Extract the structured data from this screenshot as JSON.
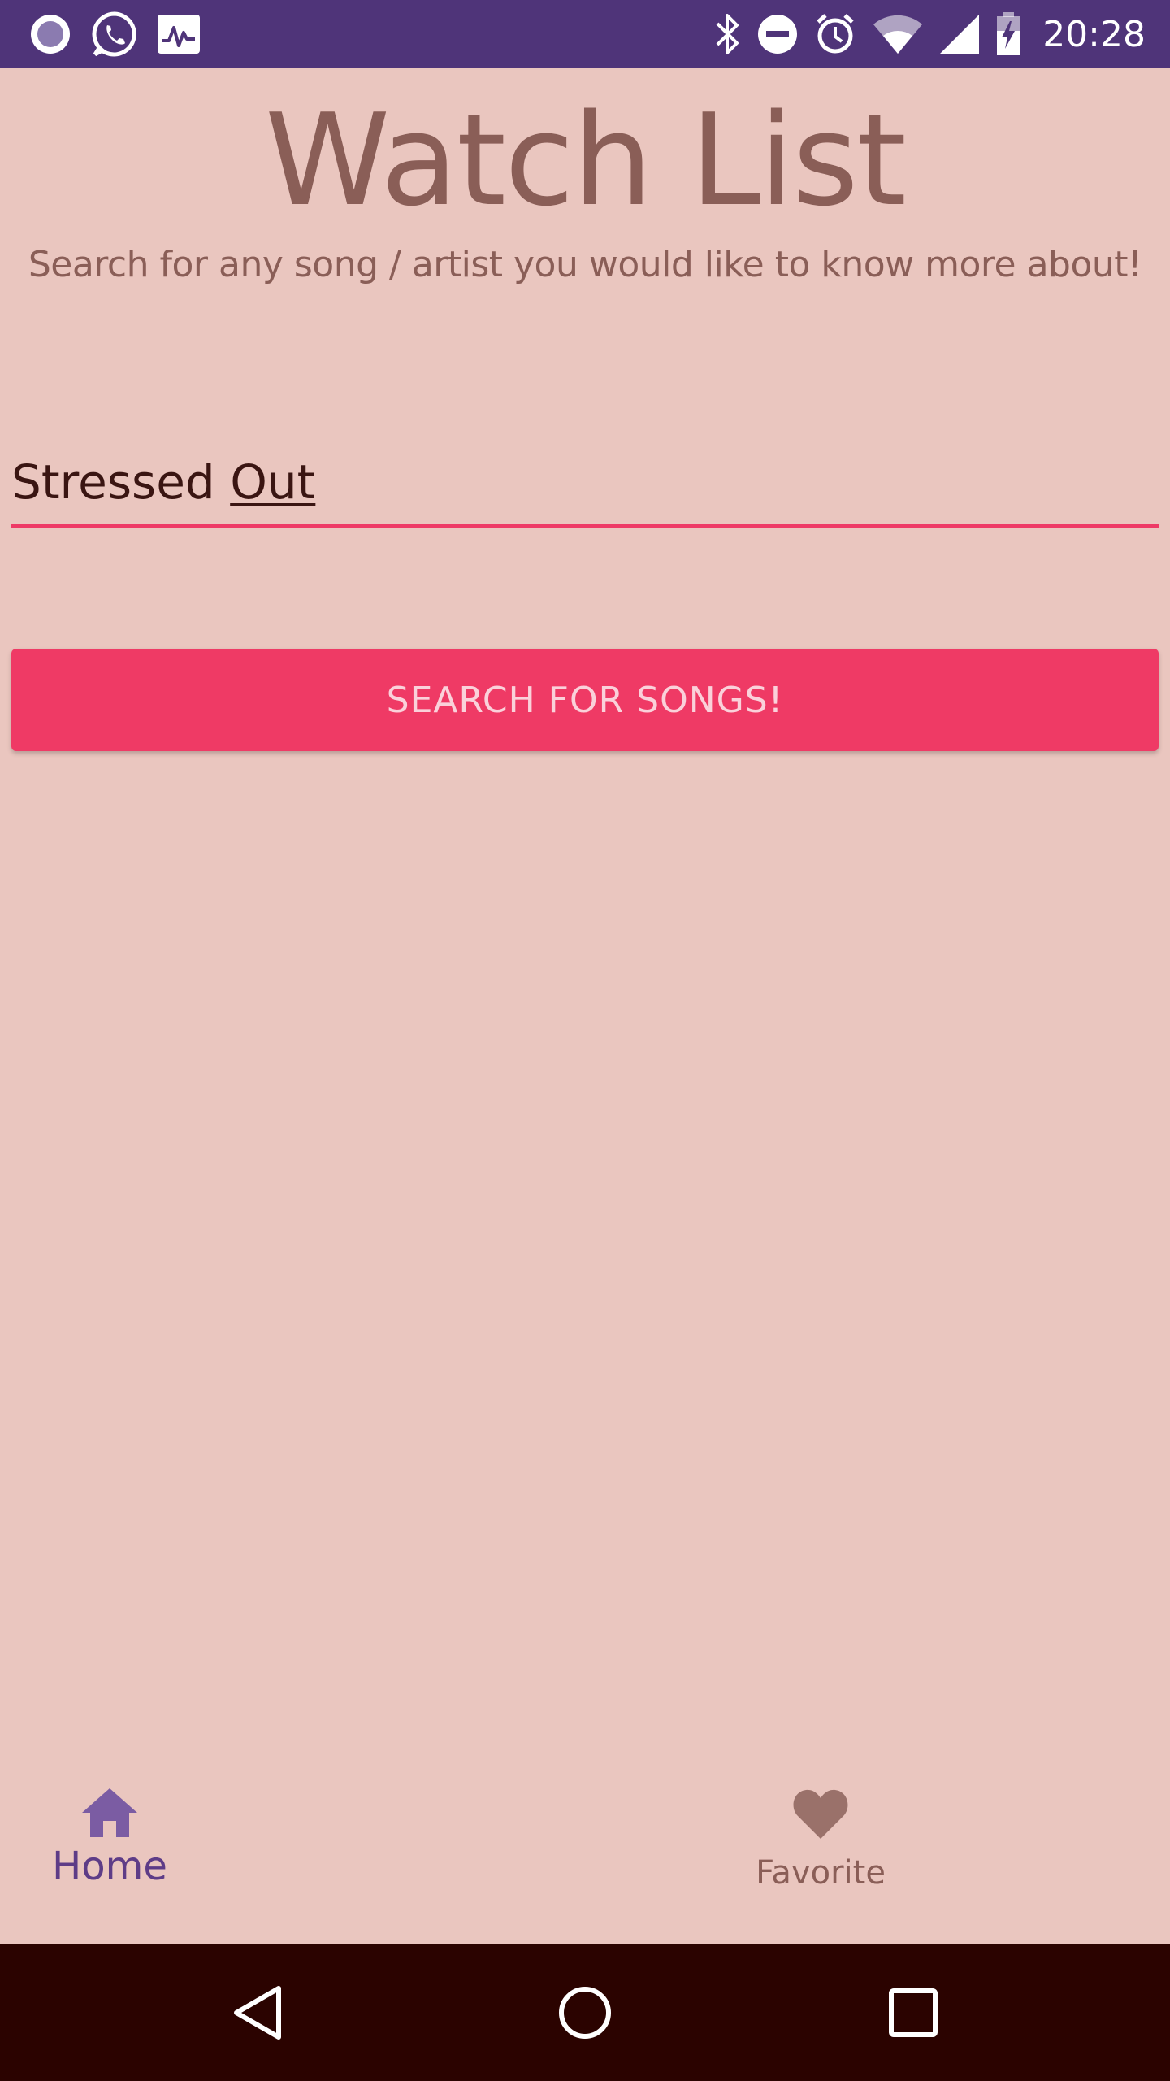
{
  "status_bar": {
    "time": "20:28",
    "left_icons": [
      "notification-dot-icon",
      "whatsapp-icon",
      "activity-monitor-icon"
    ],
    "right_icons": [
      "bluetooth-icon",
      "do-not-disturb-icon",
      "alarm-icon",
      "wifi-icon",
      "cell-signal-icon",
      "battery-charging-icon"
    ],
    "background_color": "#4F3479"
  },
  "header": {
    "title": "Watch List",
    "subtitle": "Search for any song / artist you would like to know more about!"
  },
  "search": {
    "value_prefix": "Stressed",
    "value_underlined": "Out",
    "accent_color": "#EE3A66"
  },
  "search_button": {
    "label": "SEARCH FOR SONGS!",
    "color": "#EF3A65"
  },
  "bottom_nav": {
    "items": [
      {
        "label": "Home",
        "icon": "home-icon",
        "active": true
      },
      {
        "label": "Favorite",
        "icon": "heart-icon",
        "active": false
      }
    ],
    "active_color": "#5E3C87",
    "inactive_color": "#8A5E57"
  },
  "system_nav": {
    "buttons": [
      "back-icon",
      "home-circle-icon",
      "recents-icon"
    ]
  },
  "colors": {
    "background": "#EAC6BF",
    "text_primary": "#8A5E57"
  }
}
